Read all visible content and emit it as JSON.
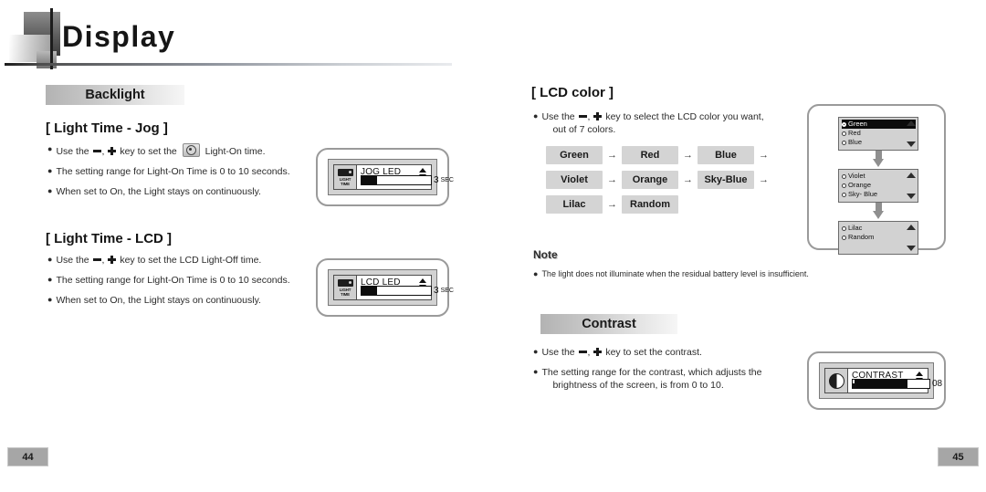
{
  "header": {
    "title": "Display"
  },
  "left_page": {
    "section_title": "Backlight",
    "jog": {
      "heading": "[ Light Time - Jog ]",
      "bullets": [
        {
          "pre": "Use the",
          "mid": "key to set the",
          "post": "Light-On time."
        },
        {
          "text": "The setting range for Light-On Time is 0 to 10 seconds."
        },
        {
          "text": "When set to On, the Light stays on continuously."
        }
      ],
      "device": {
        "icon_label_line1": "LIGHT",
        "icon_label_line2": "TIME",
        "title": "JOG LED",
        "value": "3",
        "unit": "SEC",
        "fill_percent": 22
      }
    },
    "lcd": {
      "heading": "[ Light Time - LCD ]",
      "bullets": [
        {
          "pre": "Use the",
          "mid": "key to set the LCD Light-Off time."
        },
        {
          "text": "The setting range for Light-On Time is 0 to 10 seconds."
        },
        {
          "text": "When set to On, the Light stays on continuously."
        }
      ],
      "device": {
        "icon_label_line1": "LIGHT",
        "icon_label_line2": "TIME",
        "title": "LCD LED",
        "value": "3",
        "unit": "SEC",
        "fill_percent": 22
      }
    },
    "page_number": "44"
  },
  "right_page": {
    "lcd_color": {
      "heading": "[ LCD color ]",
      "bullet_pre": "Use the",
      "bullet_mid": "key to select the LCD color you want,",
      "bullet_cont": "out of 7 colors.",
      "chips": [
        [
          "Green",
          "Red",
          "Blue"
        ],
        [
          "Violet",
          "Orange",
          "Sky-Blue"
        ],
        [
          "Lilac",
          "Random"
        ]
      ],
      "arrow_glyph": "→",
      "pickers": [
        {
          "options": [
            {
              "label": "Green",
              "selected": true
            },
            {
              "label": "Red",
              "selected": false
            },
            {
              "label": "Blue",
              "selected": false
            }
          ]
        },
        {
          "options": [
            {
              "label": "Violet",
              "selected": false
            },
            {
              "label": "Orange",
              "selected": false
            },
            {
              "label": "Sky- Blue",
              "selected": false
            }
          ]
        },
        {
          "options": [
            {
              "label": "Lilac",
              "selected": false
            },
            {
              "label": "Random",
              "selected": false
            }
          ]
        }
      ]
    },
    "note": {
      "label": "Note",
      "text": "The light does not illuminate when the residual battery level is insufficient."
    },
    "contrast": {
      "section_title": "Contrast",
      "bullets": [
        {
          "pre": "Use the",
          "mid": "key to set the contrast."
        },
        {
          "text": "The setting range for the contrast, which adjusts the",
          "cont": "brightness of the screen, is from 0 to 10."
        }
      ],
      "device": {
        "title": "CONTRAST",
        "value": "08",
        "fill_percent": 70
      }
    },
    "page_number": "45"
  },
  "colors": {
    "bar_start": "#b3b3b3",
    "bar_end": "#f6f6f6",
    "chip_bg": "#d4d4d4",
    "page_badge": "#a6a6a6",
    "ink": "#1a1a1a"
  }
}
